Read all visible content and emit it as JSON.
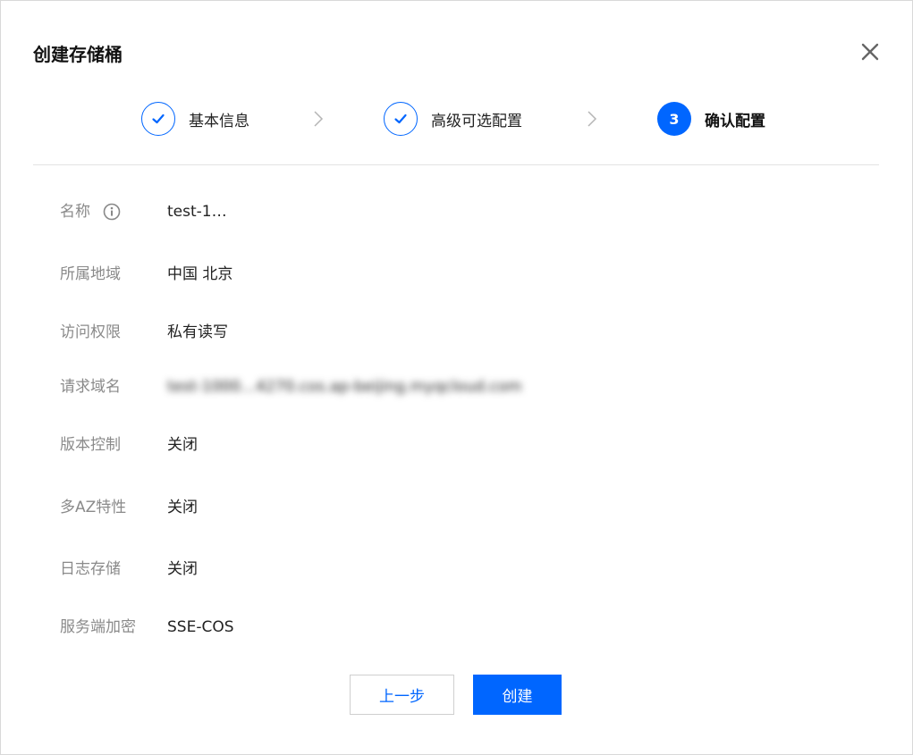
{
  "dialog": {
    "title": "创建存储桶"
  },
  "steps": [
    {
      "label": "基本信息",
      "state": "done"
    },
    {
      "label": "高级可选配置",
      "state": "done"
    },
    {
      "number": "3",
      "label": "确认配置",
      "state": "active"
    }
  ],
  "fields": {
    "name": {
      "label": "名称",
      "value": "test-1…"
    },
    "region": {
      "label": "所属地域",
      "value": "中国 北京"
    },
    "access": {
      "label": "访问权限",
      "value": "私有读写"
    },
    "domain": {
      "label": "请求域名",
      "value": "test-1000…4270.cos.ap-beijing.myqcloud.com"
    },
    "versioning": {
      "label": "版本控制",
      "value": "关闭"
    },
    "multi_az": {
      "label": "多AZ特性",
      "value": "关闭"
    },
    "logging": {
      "label": "日志存储",
      "value": "关闭"
    },
    "encryption": {
      "label": "服务端加密",
      "value": "SSE-COS"
    }
  },
  "buttons": {
    "prev": "上一步",
    "create": "创建"
  },
  "colors": {
    "accent": "#0066ff",
    "label": "#8a8a8a",
    "text": "#222222",
    "border": "#e3e3e3"
  },
  "icons": {
    "close": "close-icon",
    "check": "check-icon",
    "chevron": "chevron-right-icon",
    "info": "info-icon"
  }
}
